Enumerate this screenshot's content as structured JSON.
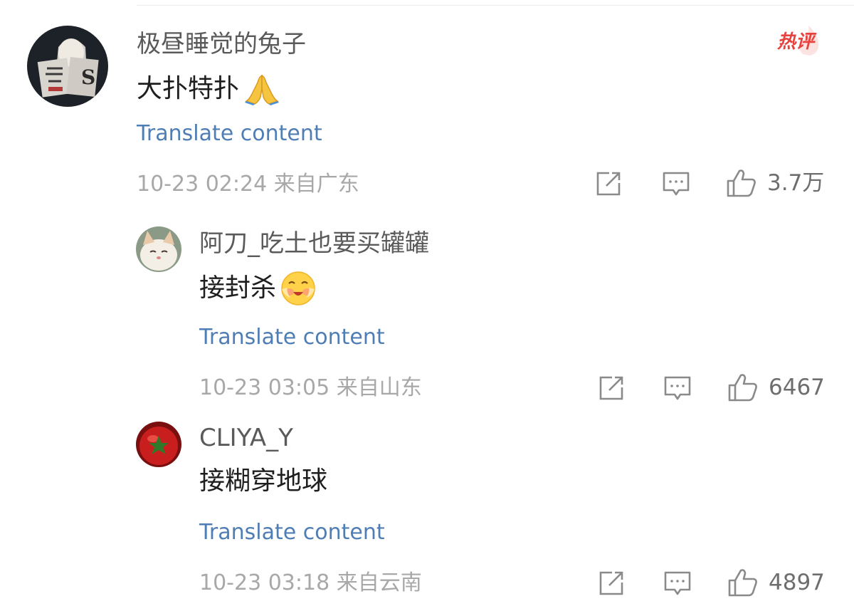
{
  "comments": [
    {
      "username": "极昼睡觉的兔子",
      "text": "大扑特扑",
      "emoji": "folded-hands-emoji",
      "translate_label": "Translate content",
      "meta": "10-23 02:24 来自广东",
      "likes": "3.7万",
      "badge": "热评"
    },
    {
      "username": "阿刀_吃土也要买罐罐",
      "text": "接封杀",
      "emoji": "shy-smile-emoji",
      "translate_label": "Translate content",
      "meta": "10-23 03:05 来自山东",
      "likes": "6467"
    },
    {
      "username": "CLIYA_Y",
      "text": "接糊穿地球",
      "translate_label": "Translate content",
      "meta": "10-23 03:18 来自云南",
      "likes": "4897"
    }
  ],
  "colors": {
    "link": "#4f7eb5",
    "hot_badge": "#e8423f",
    "meta": "#a8a8a8"
  }
}
